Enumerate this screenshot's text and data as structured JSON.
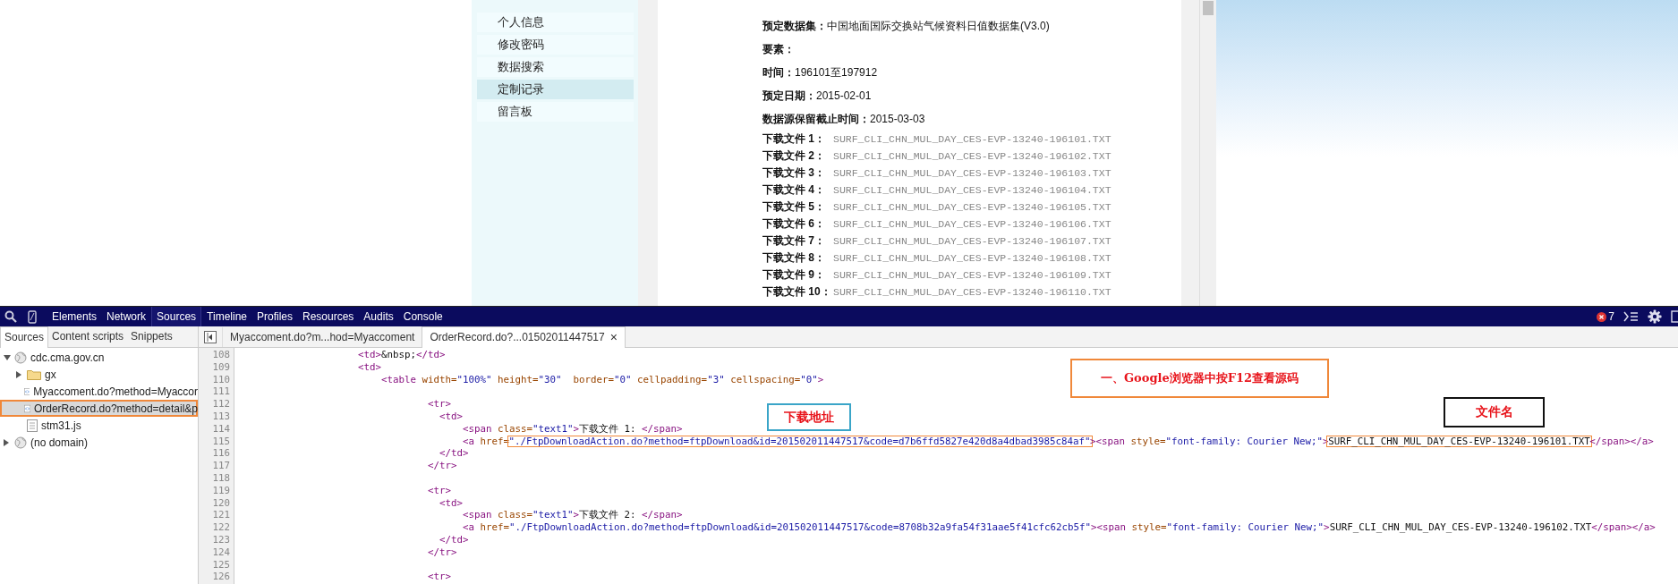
{
  "page": {
    "sidebar_items": [
      {
        "label": "个人信息",
        "selected": false
      },
      {
        "label": "修改密码",
        "selected": false
      },
      {
        "label": "数据搜索",
        "selected": false
      },
      {
        "label": "定制记录",
        "selected": true
      },
      {
        "label": "留言板",
        "selected": false
      }
    ],
    "details": [
      {
        "label": "预定数据集：",
        "value": "中国地面国际交换站气候资料日值数据集(V3.0)"
      },
      {
        "label": "要素："
      },
      {
        "label": "时间：",
        "value": "196101至197912"
      },
      {
        "label": "预定日期：",
        "value": "2015-02-01"
      },
      {
        "label": "数据源保留截止时间：",
        "value": "2015-03-03"
      }
    ],
    "downloads": [
      {
        "label": "下载文件 1：",
        "file": "SURF_CLI_CHN_MUL_DAY_CES-EVP-13240-196101.TXT"
      },
      {
        "label": "下载文件 2：",
        "file": "SURF_CLI_CHN_MUL_DAY_CES-EVP-13240-196102.TXT"
      },
      {
        "label": "下载文件 3：",
        "file": "SURF_CLI_CHN_MUL_DAY_CES-EVP-13240-196103.TXT"
      },
      {
        "label": "下载文件 4：",
        "file": "SURF_CLI_CHN_MUL_DAY_CES-EVP-13240-196104.TXT"
      },
      {
        "label": "下载文件 5：",
        "file": "SURF_CLI_CHN_MUL_DAY_CES-EVP-13240-196105.TXT"
      },
      {
        "label": "下载文件 6：",
        "file": "SURF_CLI_CHN_MUL_DAY_CES-EVP-13240-196106.TXT"
      },
      {
        "label": "下载文件 7：",
        "file": "SURF_CLI_CHN_MUL_DAY_CES-EVP-13240-196107.TXT"
      },
      {
        "label": "下载文件 8：",
        "file": "SURF_CLI_CHN_MUL_DAY_CES-EVP-13240-196108.TXT"
      },
      {
        "label": "下载文件 9：",
        "file": "SURF_CLI_CHN_MUL_DAY_CES-EVP-13240-196109.TXT"
      },
      {
        "label": "下载文件 10：",
        "file": "SURF_CLI_CHN_MUL_DAY_CES-EVP-13240-196110.TXT"
      }
    ]
  },
  "devtools": {
    "panels": [
      {
        "label": "Elements",
        "selected": false
      },
      {
        "label": "Network",
        "selected": false
      },
      {
        "label": "Sources",
        "selected": true
      },
      {
        "label": "Timeline",
        "selected": false
      },
      {
        "label": "Profiles",
        "selected": false
      },
      {
        "label": "Resources",
        "selected": false
      },
      {
        "label": "Audits",
        "selected": false
      },
      {
        "label": "Console",
        "selected": false
      }
    ],
    "error_count": "7",
    "navigator_tabs": [
      {
        "label": "Sources",
        "selected": true
      },
      {
        "label": "Content scripts",
        "selected": false
      },
      {
        "label": "Snippets",
        "selected": false
      }
    ],
    "tree": [
      {
        "label": "cdc.cma.gov.cn",
        "kind": "domain",
        "expanded": true,
        "selected": false,
        "annotated": false,
        "children": [
          {
            "label": "gx",
            "kind": "folder",
            "expanded": false,
            "selected": false,
            "annotated": false
          },
          {
            "label": "Myaccoment.do?method=Myaccor",
            "kind": "document",
            "selected": false,
            "annotated": false
          },
          {
            "label": "OrderRecord.do?method=detail&p",
            "kind": "document",
            "selected": true,
            "annotated": true
          },
          {
            "label": "stm31.js",
            "kind": "script",
            "selected": false,
            "annotated": false
          }
        ]
      },
      {
        "label": "(no domain)",
        "kind": "domain",
        "expanded": false,
        "selected": false,
        "annotated": false
      }
    ],
    "editor_tabs": [
      {
        "label": "Myaccoment.do?m...hod=Myaccoment",
        "selected": false
      },
      {
        "label": "OrderRecord.do?...01502011447517",
        "selected": true,
        "close": "×"
      }
    ],
    "lines": [
      {
        "number": "108",
        "tokens": [
          {
            "kind": "tag",
            "text": "                    <td>"
          },
          {
            "kind": "text",
            "text": "&nbsp;"
          },
          {
            "kind": "tag",
            "text": "</td>"
          }
        ]
      },
      {
        "number": "109",
        "tokens": [
          {
            "kind": "tag",
            "text": "                    <td>"
          }
        ]
      },
      {
        "number": "110",
        "tokens": [
          {
            "kind": "tag",
            "text": "                        <table"
          },
          {
            "kind": "attr",
            "text": " width="
          },
          {
            "kind": "value",
            "text": "\"100%\""
          },
          {
            "kind": "attr",
            "text": " height="
          },
          {
            "kind": "value",
            "text": "\"30\""
          },
          {
            "kind": "attr",
            "text": "  border="
          },
          {
            "kind": "value",
            "text": "\"0\""
          },
          {
            "kind": "attr",
            "text": " cellpadding="
          },
          {
            "kind": "value",
            "text": "\"3\""
          },
          {
            "kind": "attr",
            "text": " cellspacing="
          },
          {
            "kind": "value",
            "text": "\"0\""
          },
          {
            "kind": "tag",
            "text": ">"
          }
        ]
      },
      {
        "number": "111"
      },
      {
        "number": "112",
        "tokens": [
          {
            "kind": "tag",
            "text": "                                <tr>"
          }
        ]
      },
      {
        "number": "113",
        "tokens": [
          {
            "kind": "tag",
            "text": "                                  <td>"
          }
        ]
      },
      {
        "number": "114",
        "tokens": [
          {
            "kind": "tag",
            "text": "                                      <span"
          },
          {
            "kind": "attr",
            "text": " class="
          },
          {
            "kind": "value",
            "text": "\"text1\""
          },
          {
            "kind": "tag",
            "text": ">"
          },
          {
            "kind": "text",
            "text": "下载文件 1: "
          },
          {
            "kind": "tag",
            "text": "</span>"
          }
        ]
      },
      {
        "number": "115",
        "tokens": [
          {
            "kind": "tag",
            "text": "                                      <a"
          },
          {
            "kind": "attr",
            "text": " href="
          },
          {
            "kind": "boxed-value",
            "text": "\"./FtpDownloadAction.do?method=ftpDownload&id=201502011447517&code=d7b6ffd5827e420d8a4dbad3985c84af\""
          },
          {
            "kind": "tag",
            "text": "><span"
          },
          {
            "kind": "attr",
            "text": " style="
          },
          {
            "kind": "value",
            "text": "\"font-family: Courier New;\""
          },
          {
            "kind": "tag",
            "text": ">"
          },
          {
            "kind": "boxed-text",
            "text": "SURF_CLI_CHN_MUL_DAY_CES-EVP-13240-196101.TXT"
          },
          {
            "kind": "tag",
            "text": "</span></a>"
          }
        ]
      },
      {
        "number": "116",
        "tokens": [
          {
            "kind": "tag",
            "text": "                                  </td>"
          }
        ]
      },
      {
        "number": "117",
        "tokens": [
          {
            "kind": "tag",
            "text": "                                </tr>"
          }
        ]
      },
      {
        "number": "118"
      },
      {
        "number": "119",
        "tokens": [
          {
            "kind": "tag",
            "text": "                                <tr>"
          }
        ]
      },
      {
        "number": "120",
        "tokens": [
          {
            "kind": "tag",
            "text": "                                  <td>"
          }
        ]
      },
      {
        "number": "121",
        "tokens": [
          {
            "kind": "tag",
            "text": "                                      <span"
          },
          {
            "kind": "attr",
            "text": " class="
          },
          {
            "kind": "value",
            "text": "\"text1\""
          },
          {
            "kind": "tag",
            "text": ">"
          },
          {
            "kind": "text",
            "text": "下载文件 2: "
          },
          {
            "kind": "tag",
            "text": "</span>"
          }
        ]
      },
      {
        "number": "122",
        "tokens": [
          {
            "kind": "tag",
            "text": "                                      <a"
          },
          {
            "kind": "attr",
            "text": " href="
          },
          {
            "kind": "value",
            "text": "\"./FtpDownloadAction.do?method=ftpDownload&id=201502011447517&code=8708b32a9fa54f31aae5f41cfc62cb5f\""
          },
          {
            "kind": "tag",
            "text": "><span"
          },
          {
            "kind": "attr",
            "text": " style="
          },
          {
            "kind": "value",
            "text": "\"font-family: Courier New;\""
          },
          {
            "kind": "tag",
            "text": ">"
          },
          {
            "kind": "text",
            "text": "SURF_CLI_CHN_MUL_DAY_CES-EVP-13240-196102.TXT"
          },
          {
            "kind": "tag",
            "text": "</span></a>"
          }
        ]
      },
      {
        "number": "123",
        "tokens": [
          {
            "kind": "tag",
            "text": "                                  </td>"
          }
        ]
      },
      {
        "number": "124",
        "tokens": [
          {
            "kind": "tag",
            "text": "                                </tr>"
          }
        ]
      },
      {
        "number": "125"
      },
      {
        "number": "126",
        "tokens": [
          {
            "kind": "tag",
            "text": "                                <tr>"
          }
        ]
      }
    ],
    "annotations": [
      {
        "kind": "title",
        "text": "一、Google浏览器中按F12查看源码"
      },
      {
        "kind": "address",
        "text": "下载地址"
      },
      {
        "kind": "filename",
        "text": "文件名"
      }
    ]
  }
}
